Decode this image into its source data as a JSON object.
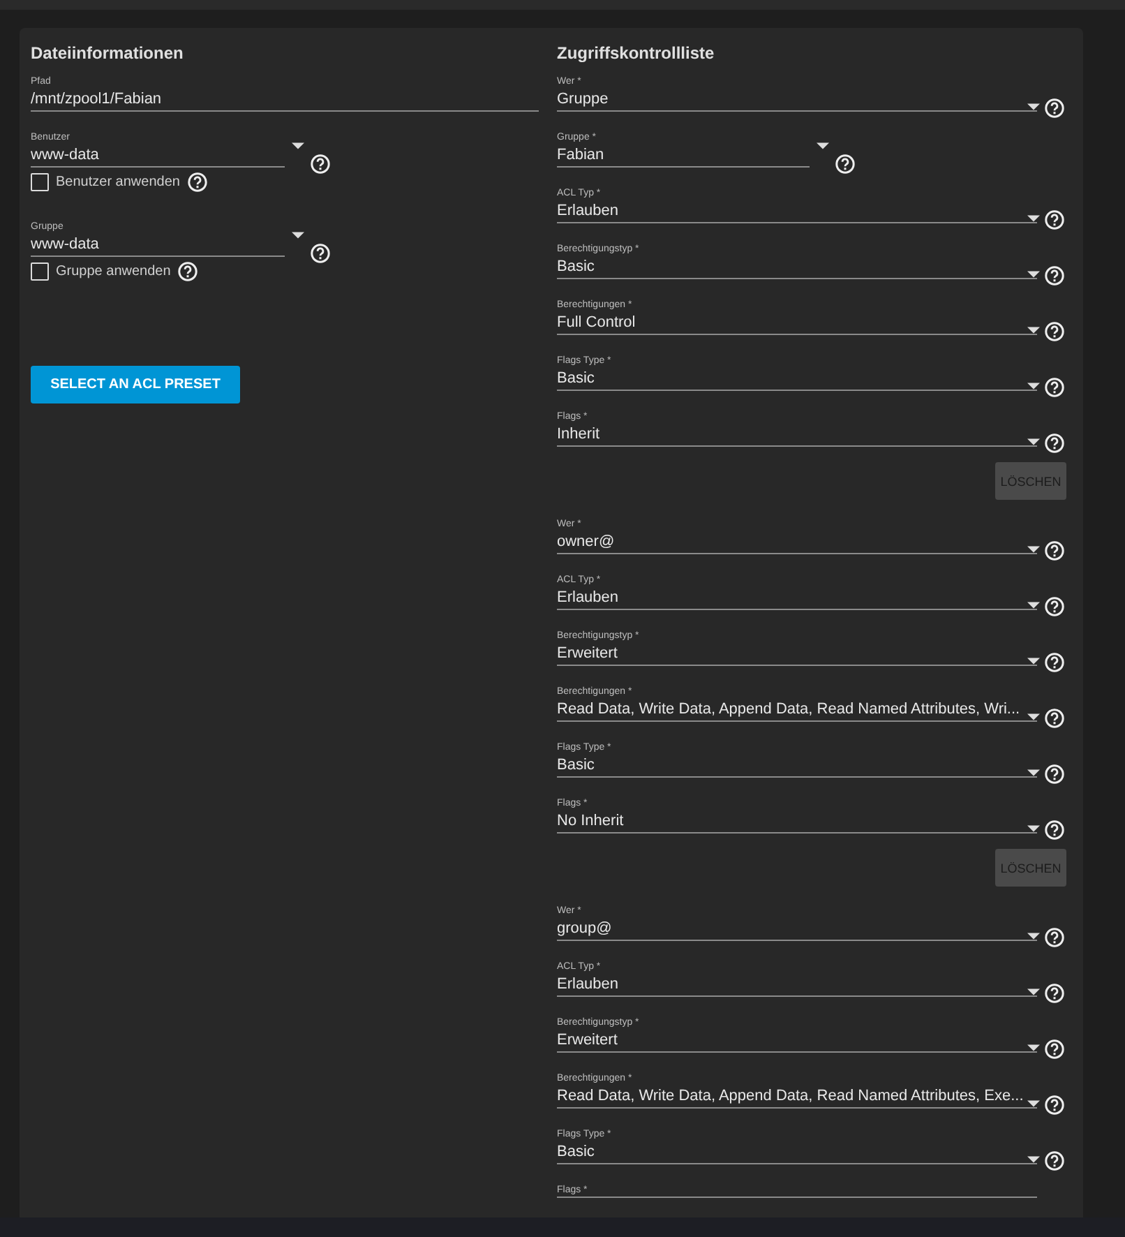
{
  "file_info": {
    "title": "Dateiinformationen",
    "fields": [
      {
        "kind": "text",
        "label": "Pfad",
        "value": "/mnt/zpool1/Fabian"
      },
      {
        "kind": "combobox",
        "label": "Benutzer",
        "value": "www-data",
        "help": true,
        "checkbox": {
          "label": "Benutzer anwenden",
          "checked": false
        }
      },
      {
        "kind": "combobox",
        "label": "Gruppe",
        "value": "www-data",
        "help": true,
        "checkbox": {
          "label": "Gruppe anwenden",
          "checked": false
        }
      }
    ],
    "preset_button": "SELECT AN ACL PRESET"
  },
  "acl": {
    "title": "Zugriffskontrollliste",
    "entries": [
      {
        "fields": [
          {
            "kind": "select",
            "label": "Wer *",
            "value": "Gruppe",
            "help": true
          },
          {
            "kind": "combobox",
            "label": "Gruppe *",
            "value": "Fabian",
            "help": true
          },
          {
            "kind": "select",
            "label": "ACL Typ *",
            "value": "Erlauben",
            "help": true
          },
          {
            "kind": "select",
            "label": "Berechtigungstyp *",
            "value": "Basic",
            "help": true
          },
          {
            "kind": "select",
            "label": "Berechtigungen *",
            "value": "Full Control",
            "help": true
          },
          {
            "kind": "select",
            "label": "Flags Type *",
            "value": "Basic",
            "help": true
          },
          {
            "kind": "select",
            "label": "Flags *",
            "value": "Inherit",
            "help": true
          }
        ],
        "delete_button": {
          "label": "LÖSCHEN",
          "disabled": true
        }
      },
      {
        "fields": [
          {
            "kind": "select",
            "label": "Wer *",
            "value": "owner@",
            "help": true
          },
          {
            "kind": "select",
            "label": "ACL Typ *",
            "value": "Erlauben",
            "help": true
          },
          {
            "kind": "select",
            "label": "Berechtigungstyp *",
            "value": "Erweitert",
            "help": true
          },
          {
            "kind": "select",
            "label": "Berechtigungen *",
            "value": "Read Data, Write Data, Append Data, Read Named Attributes, Wri...",
            "help": true
          },
          {
            "kind": "select",
            "label": "Flags Type *",
            "value": "Basic",
            "help": true
          },
          {
            "kind": "select",
            "label": "Flags *",
            "value": "No Inherit",
            "help": true
          }
        ],
        "delete_button": {
          "label": "LÖSCHEN",
          "disabled": true
        }
      },
      {
        "fields": [
          {
            "kind": "select",
            "label": "Wer *",
            "value": "group@",
            "help": true
          },
          {
            "kind": "select",
            "label": "ACL Typ *",
            "value": "Erlauben",
            "help": true
          },
          {
            "kind": "select",
            "label": "Berechtigungstyp *",
            "value": "Erweitert",
            "help": true
          },
          {
            "kind": "select",
            "label": "Berechtigungen *",
            "value": "Read Data, Write Data, Append Data, Read Named Attributes, Exe...",
            "help": true
          },
          {
            "kind": "select",
            "label": "Flags Type *",
            "value": "Basic",
            "help": true
          },
          {
            "kind": "select",
            "label": "Flags *"
          }
        ]
      }
    ]
  }
}
